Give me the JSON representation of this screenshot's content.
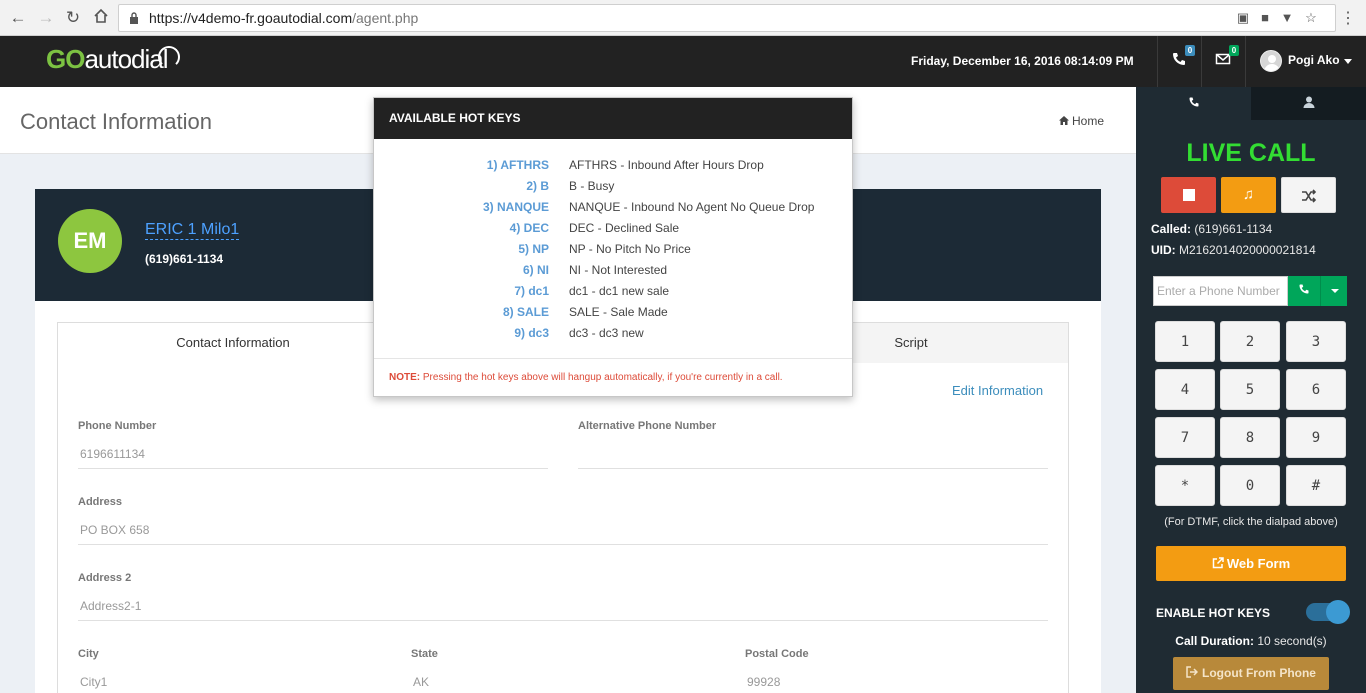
{
  "browser": {
    "url_host": "https://v4demo-fr.goautodial.com",
    "url_path": "/agent.php"
  },
  "header": {
    "logo_go": "GO",
    "logo_rest": "autodial",
    "datetime": "Friday, December 16, 2016 08:14:09 PM",
    "calls_badge": "0",
    "messages_badge": "0",
    "user_name": "Pogi Ako"
  },
  "content": {
    "page_title": "Contact Information",
    "breadcrumb_home": "Home"
  },
  "contact": {
    "initials": "EM",
    "name": "ERIC 1 Milo1",
    "phone": "(619)661-1134"
  },
  "tabs": [
    {
      "label": "Contact Information"
    },
    {
      "label": "Script"
    }
  ],
  "form": {
    "edit_link": "Edit Information",
    "phone_label": "Phone Number",
    "phone_value": "6196611134",
    "alt_phone_label": "Alternative Phone Number",
    "alt_phone_value": "",
    "address_label": "Address",
    "address_value": "PO BOX 658",
    "address2_label": "Address 2",
    "address2_value": "Address2-1",
    "city_label": "City",
    "city_value": "City1",
    "state_label": "State",
    "state_value": "AK",
    "postal_label": "Postal Code",
    "postal_value": "99928"
  },
  "hotkeys_popup": {
    "title": "AVAILABLE HOT KEYS",
    "items": [
      {
        "key": "1) AFTHRS",
        "desc": "AFTHRS - Inbound After Hours Drop"
      },
      {
        "key": "2) B",
        "desc": "B - Busy"
      },
      {
        "key": "3) NANQUE",
        "desc": "NANQUE - Inbound No Agent No Queue Drop"
      },
      {
        "key": "4) DEC",
        "desc": "DEC - Declined Sale"
      },
      {
        "key": "5) NP",
        "desc": "NP - No Pitch No Price"
      },
      {
        "key": "6) NI",
        "desc": "NI - Not Interested"
      },
      {
        "key": "7) dc1",
        "desc": "dc1 - dc1 new sale"
      },
      {
        "key": "8) SALE",
        "desc": "SALE - Sale Made"
      },
      {
        "key": "9) dc3",
        "desc": "dc3 - dc3 new"
      }
    ],
    "note_label": "NOTE:",
    "note_text": "Pressing the hot keys above will hangup automatically, if you're currently in a call."
  },
  "sidebar": {
    "live_call": "LIVE CALL",
    "called_label": "Called:",
    "called_value": "(619)661-1134",
    "uid_label": "UID:",
    "uid_value": "M2162014020000021814",
    "phone_placeholder": "Enter a Phone Number",
    "dialpad": [
      "1",
      "2",
      "3",
      "4",
      "5",
      "6",
      "7",
      "8",
      "9",
      "*",
      "0",
      "#"
    ],
    "dtmf_note": "(For DTMF, click the dialpad above)",
    "webform_label": "Web Form",
    "hotkeys_label": "ENABLE HOT KEYS",
    "duration_label": "Call Duration:",
    "duration_value": "10 second(s)",
    "logout_label": "Logout From Phone"
  },
  "colors": {
    "hangup": "#dd4b39",
    "music": "#f39c12",
    "transfer": "#f4f4f4",
    "live_call": "#33dd33",
    "accent": "#3c8dbc"
  }
}
